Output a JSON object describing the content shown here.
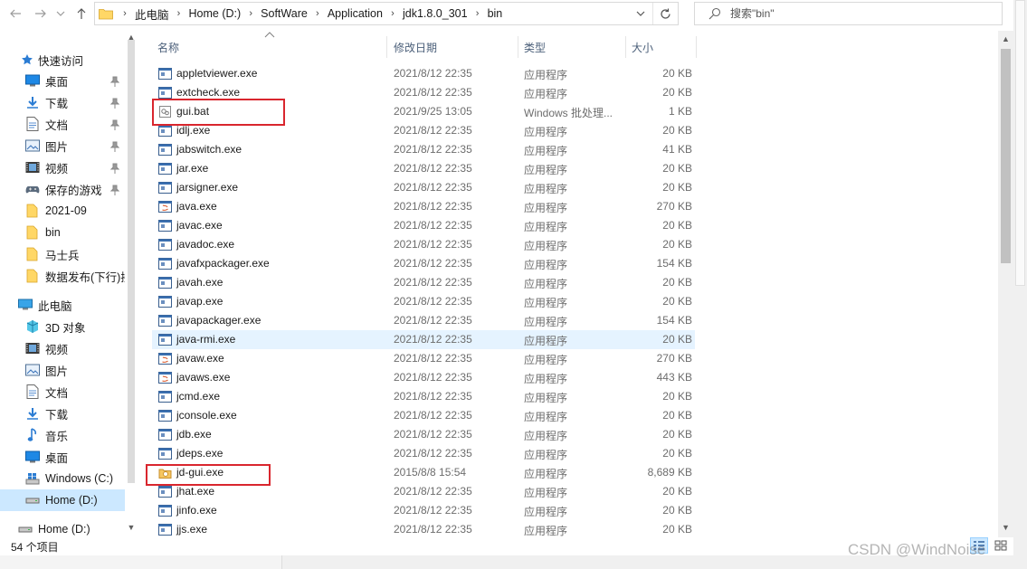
{
  "address_bar": {
    "breadcrumbs": [
      "此电脑",
      "Home (D:)",
      "SoftWare",
      "Application",
      "jdk1.8.0_301",
      "bin"
    ]
  },
  "search": {
    "placeholder": "搜索\"bin\""
  },
  "sidebar": {
    "items": [
      {
        "label": "快速访问",
        "icon": "star-icon",
        "pinned": false
      },
      {
        "label": "桌面",
        "icon": "desktop-icon",
        "pinned": true
      },
      {
        "label": "下载",
        "icon": "download-icon",
        "pinned": true
      },
      {
        "label": "文档",
        "icon": "document-icon",
        "pinned": true
      },
      {
        "label": "图片",
        "icon": "picture-icon",
        "pinned": true
      },
      {
        "label": "视频",
        "icon": "video-icon",
        "pinned": true
      },
      {
        "label": "保存的游戏",
        "icon": "saved-games-icon",
        "pinned": true
      },
      {
        "label": "2021-09",
        "icon": "folder-icon",
        "pinned": false
      },
      {
        "label": "bin",
        "icon": "folder-icon",
        "pinned": false
      },
      {
        "label": "马士兵",
        "icon": "folder-icon",
        "pinned": false
      },
      {
        "label": "数据发布(下行)接",
        "icon": "folder-icon",
        "pinned": false
      },
      {
        "label": "此电脑",
        "icon": "this-pc-icon",
        "pinned": false
      },
      {
        "label": "3D 对象",
        "icon": "3d-objects-icon",
        "pinned": false
      },
      {
        "label": "视频",
        "icon": "video-icon",
        "pinned": false
      },
      {
        "label": "图片",
        "icon": "picture-icon",
        "pinned": false
      },
      {
        "label": "文档",
        "icon": "document-icon",
        "pinned": false
      },
      {
        "label": "下载",
        "icon": "download-icon",
        "pinned": false
      },
      {
        "label": "音乐",
        "icon": "music-icon",
        "pinned": false
      },
      {
        "label": "桌面",
        "icon": "desktop-icon",
        "pinned": false
      },
      {
        "label": "Windows (C:)",
        "icon": "drive-icon",
        "pinned": false
      },
      {
        "label": "Home (D:)",
        "icon": "drive-icon",
        "pinned": false,
        "selected": true
      },
      {
        "label": "Home (D:)",
        "icon": "drive-icon",
        "pinned": false
      }
    ]
  },
  "columns": {
    "name": "名称",
    "date": "修改日期",
    "type": "类型",
    "size": "大小"
  },
  "files": [
    {
      "name": "appletviewer.exe",
      "date": "2021/8/12 22:35",
      "type": "应用程序",
      "size": "20 KB",
      "icon": "exe-icon"
    },
    {
      "name": "extcheck.exe",
      "date": "2021/8/12 22:35",
      "type": "应用程序",
      "size": "20 KB",
      "icon": "exe-icon"
    },
    {
      "name": "gui.bat",
      "date": "2021/9/25 13:05",
      "type": "Windows 批处理...",
      "size": "1 KB",
      "icon": "bat-icon"
    },
    {
      "name": "idlj.exe",
      "date": "2021/8/12 22:35",
      "type": "应用程序",
      "size": "20 KB",
      "icon": "exe-icon"
    },
    {
      "name": "jabswitch.exe",
      "date": "2021/8/12 22:35",
      "type": "应用程序",
      "size": "41 KB",
      "icon": "exe-icon"
    },
    {
      "name": "jar.exe",
      "date": "2021/8/12 22:35",
      "type": "应用程序",
      "size": "20 KB",
      "icon": "exe-icon"
    },
    {
      "name": "jarsigner.exe",
      "date": "2021/8/12 22:35",
      "type": "应用程序",
      "size": "20 KB",
      "icon": "exe-icon"
    },
    {
      "name": "java.exe",
      "date": "2021/8/12 22:35",
      "type": "应用程序",
      "size": "270 KB",
      "icon": "java-icon"
    },
    {
      "name": "javac.exe",
      "date": "2021/8/12 22:35",
      "type": "应用程序",
      "size": "20 KB",
      "icon": "exe-icon"
    },
    {
      "name": "javadoc.exe",
      "date": "2021/8/12 22:35",
      "type": "应用程序",
      "size": "20 KB",
      "icon": "exe-icon"
    },
    {
      "name": "javafxpackager.exe",
      "date": "2021/8/12 22:35",
      "type": "应用程序",
      "size": "154 KB",
      "icon": "exe-icon"
    },
    {
      "name": "javah.exe",
      "date": "2021/8/12 22:35",
      "type": "应用程序",
      "size": "20 KB",
      "icon": "exe-icon"
    },
    {
      "name": "javap.exe",
      "date": "2021/8/12 22:35",
      "type": "应用程序",
      "size": "20 KB",
      "icon": "exe-icon"
    },
    {
      "name": "javapackager.exe",
      "date": "2021/8/12 22:35",
      "type": "应用程序",
      "size": "154 KB",
      "icon": "exe-icon"
    },
    {
      "name": "java-rmi.exe",
      "date": "2021/8/12 22:35",
      "type": "应用程序",
      "size": "20 KB",
      "icon": "exe-icon",
      "hover": true
    },
    {
      "name": "javaw.exe",
      "date": "2021/8/12 22:35",
      "type": "应用程序",
      "size": "270 KB",
      "icon": "java-icon"
    },
    {
      "name": "javaws.exe",
      "date": "2021/8/12 22:35",
      "type": "应用程序",
      "size": "443 KB",
      "icon": "java-icon"
    },
    {
      "name": "jcmd.exe",
      "date": "2021/8/12 22:35",
      "type": "应用程序",
      "size": "20 KB",
      "icon": "exe-icon"
    },
    {
      "name": "jconsole.exe",
      "date": "2021/8/12 22:35",
      "type": "应用程序",
      "size": "20 KB",
      "icon": "exe-icon"
    },
    {
      "name": "jdb.exe",
      "date": "2021/8/12 22:35",
      "type": "应用程序",
      "size": "20 KB",
      "icon": "exe-icon"
    },
    {
      "name": "jdeps.exe",
      "date": "2021/8/12 22:35",
      "type": "应用程序",
      "size": "20 KB",
      "icon": "exe-icon"
    },
    {
      "name": "jd-gui.exe",
      "date": "2015/8/8 15:54",
      "type": "应用程序",
      "size": "8,689 KB",
      "icon": "jd-gui-icon"
    },
    {
      "name": "jhat.exe",
      "date": "2021/8/12 22:35",
      "type": "应用程序",
      "size": "20 KB",
      "icon": "exe-icon"
    },
    {
      "name": "jinfo.exe",
      "date": "2021/8/12 22:35",
      "type": "应用程序",
      "size": "20 KB",
      "icon": "exe-icon"
    },
    {
      "name": "jjs.exe",
      "date": "2021/8/12 22:35",
      "type": "应用程序",
      "size": "20 KB",
      "icon": "exe-icon"
    }
  ],
  "status": {
    "item_count": "54 个项目"
  },
  "watermark": "CSDN @WindNoise",
  "colors": {
    "selection": "#cce8ff",
    "hover": "#e5f3ff",
    "highlight_border": "#d9262e",
    "header_text": "#4c607a"
  }
}
